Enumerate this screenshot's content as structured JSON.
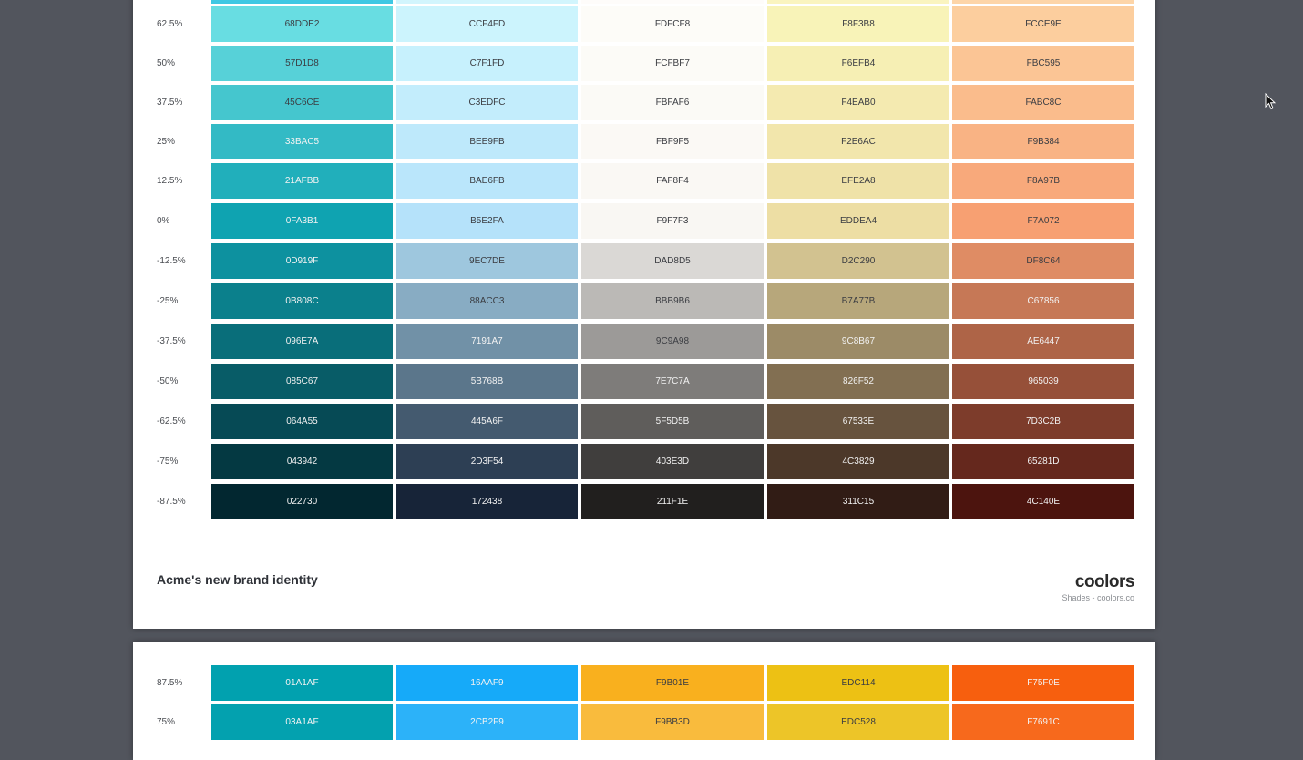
{
  "page1": {
    "rows": [
      {
        "pct": "",
        "colors": [
          "3FC8E3",
          "D2F5FD",
          "FEFCFA",
          "FAF4C0",
          "FDD5A8"
        ],
        "labels": [
          "",
          "",
          "",
          "",
          ""
        ]
      },
      {
        "pct": "62.5%",
        "colors": [
          "68DDE2",
          "CCF4FD",
          "FDFCF8",
          "F8F3B8",
          "FCCE9E"
        ],
        "labels": [
          "68DDE2",
          "CCF4FD",
          "FDFCF8",
          "F8F3B8",
          "FCCE9E"
        ]
      },
      {
        "pct": "50%",
        "colors": [
          "57D1D8",
          "C7F1FD",
          "FCFBF7",
          "F6EFB4",
          "FBC595"
        ],
        "labels": [
          "57D1D8",
          "C7F1FD",
          "FCFBF7",
          "F6EFB4",
          "FBC595"
        ]
      },
      {
        "pct": "37.5%",
        "colors": [
          "45C6CE",
          "C3EDFC",
          "FBFAF6",
          "F4EAB0",
          "FABC8C"
        ],
        "labels": [
          "45C6CE",
          "C3EDFC",
          "FBFAF6",
          "F4EAB0",
          "FABC8C"
        ]
      },
      {
        "pct": "25%",
        "colors": [
          "33BAC5",
          "BEE9FB",
          "FBF9F5",
          "F2E6AC",
          "F9B384"
        ],
        "labels": [
          "33BAC5",
          "BEE9FB",
          "FBF9F5",
          "F2E6AC",
          "F9B384"
        ]
      },
      {
        "pct": "12.5%",
        "colors": [
          "21AFBB",
          "BAE6FB",
          "FAF8F4",
          "EFE2A8",
          "F8A97B"
        ],
        "labels": [
          "21AFBB",
          "BAE6FB",
          "FAF8F4",
          "EFE2A8",
          "F8A97B"
        ]
      },
      {
        "pct": "0%",
        "colors": [
          "0FA3B1",
          "B5E2FA",
          "F9F7F3",
          "EDDEA4",
          "F7A072"
        ],
        "labels": [
          "0FA3B1",
          "B5E2FA",
          "F9F7F3",
          "EDDEA4",
          "F7A072"
        ]
      },
      {
        "pct": "-12.5%",
        "colors": [
          "0D919F",
          "9EC7DE",
          "DAD8D5",
          "D2C290",
          "DF8C64"
        ],
        "labels": [
          "0D919F",
          "9EC7DE",
          "DAD8D5",
          "D2C290",
          "DF8C64"
        ]
      },
      {
        "pct": "-25%",
        "colors": [
          "0B808C",
          "88ACC3",
          "BBB9B6",
          "B7A77B",
          "C67856"
        ],
        "labels": [
          "0B808C",
          "88ACC3",
          "BBB9B6",
          "B7A77B",
          "C67856"
        ]
      },
      {
        "pct": "-37.5%",
        "colors": [
          "096E7A",
          "7191A7",
          "9C9A98",
          "9C8B67",
          "AE6447"
        ],
        "labels": [
          "096E7A",
          "7191A7",
          "9C9A98",
          "9C8B67",
          "AE6447"
        ]
      },
      {
        "pct": "-50%",
        "colors": [
          "085C67",
          "5B768B",
          "7E7C7A",
          "826F52",
          "965039"
        ],
        "labels": [
          "085C67",
          "5B768B",
          "7E7C7A",
          "826F52",
          "965039"
        ]
      },
      {
        "pct": "-62.5%",
        "colors": [
          "064A55",
          "445A6F",
          "5F5D5B",
          "67533E",
          "7D3C2B"
        ],
        "labels": [
          "064A55",
          "445A6F",
          "5F5D5B",
          "67533E",
          "7D3C2B"
        ]
      },
      {
        "pct": "-75%",
        "colors": [
          "043942",
          "2D3F54",
          "403E3D",
          "4C3829",
          "65281D"
        ],
        "labels": [
          "043942",
          "2D3F54",
          "403E3D",
          "4C3829",
          "65281D"
        ]
      },
      {
        "pct": "-87.5%",
        "colors": [
          "022730",
          "172438",
          "211F1E",
          "311C15",
          "4C140E"
        ],
        "labels": [
          "022730",
          "172438",
          "211F1E",
          "311C15",
          "4C140E"
        ]
      }
    ],
    "title": "Acme's new brand identity",
    "logo": "coolors",
    "logo_sub": "Shades - coolors.co"
  },
  "page2": {
    "rows": [
      {
        "pct": "87.5%",
        "colors": [
          "01A1AF",
          "16AAF9",
          "F9B01E",
          "EDC114",
          "F75F0E"
        ],
        "labels": [
          "01A1AF",
          "16AAF9",
          "F9B01E",
          "EDC114",
          "F75F0E"
        ]
      },
      {
        "pct": "75%",
        "colors": [
          "03A1AF",
          "2CB2F9",
          "F9BB3D",
          "EDC528",
          "F7691C"
        ],
        "labels": [
          "03A1AF",
          "2CB2F9",
          "F9BB3D",
          "EDC528",
          "F7691C"
        ]
      }
    ]
  }
}
